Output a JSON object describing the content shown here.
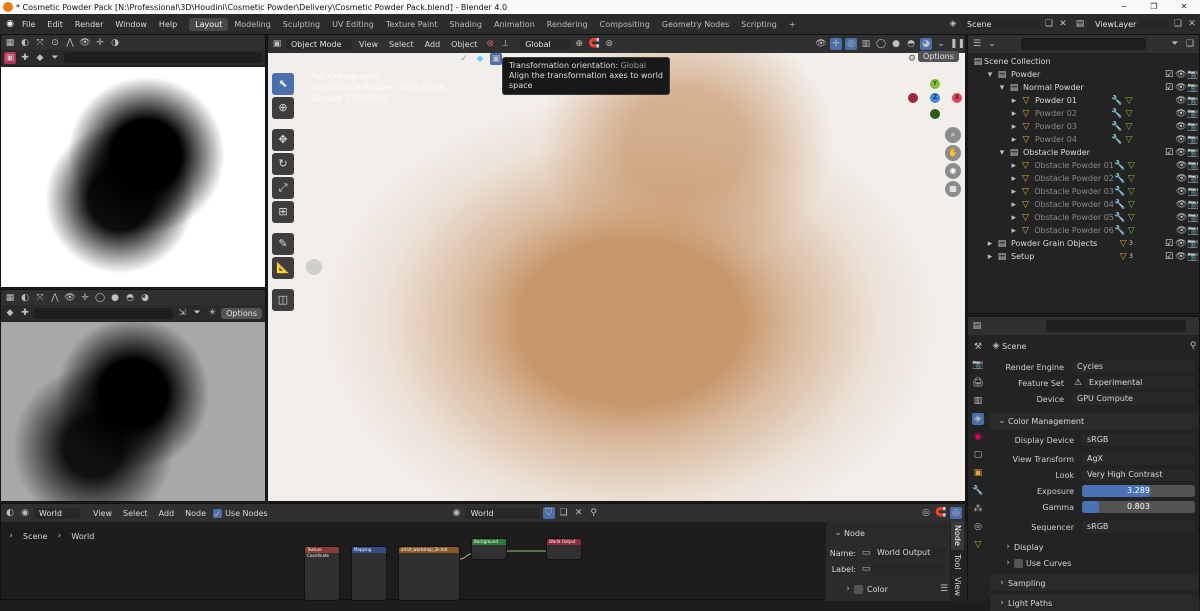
{
  "window": {
    "title": "* Cosmetic Powder Pack [N:\\Professional\\3D\\Houdini\\Cosmetic Powder\\Delivery\\Cosmetic Powder Pack.blend] - Blender 4.0",
    "minimize": "─",
    "maximize": "❐",
    "close": "✕"
  },
  "menu": [
    "File",
    "Edit",
    "Render",
    "Window",
    "Help"
  ],
  "workspaces": [
    "Layout",
    "Modeling",
    "Sculpting",
    "UV Editing",
    "Texture Paint",
    "Shading",
    "Animation",
    "Rendering",
    "Compositing",
    "Geometry Nodes",
    "Scripting"
  ],
  "workspace_add": "+",
  "scene": {
    "label": "Scene",
    "view_layer": "ViewLayer"
  },
  "left_bottom_header": {
    "options": "Options"
  },
  "viewport": {
    "mode": "Object Mode",
    "menu": [
      "View",
      "Select",
      "Add",
      "Object"
    ],
    "orientation": "Global",
    "options": "Options",
    "overlay_lines": [
      "Top Orthographic",
      "(1) Obstacle Powder | Base Plane",
      "Sample 1767/5000"
    ],
    "tooltip_title": "Transformation orientation:",
    "tooltip_value": "Global",
    "tooltip_desc": "Align the transformation axes to world space",
    "gizmo": {
      "y": "Y",
      "x": "X",
      "z": "Z"
    }
  },
  "outliner": {
    "root": "Scene Collection",
    "items": [
      {
        "label": "Powder",
        "level": 1
      },
      {
        "label": "Normal Powder",
        "level": 2
      },
      {
        "label": "Powder 01",
        "level": 3
      },
      {
        "label": "Powder 02",
        "level": 3
      },
      {
        "label": "Powder 03",
        "level": 3
      },
      {
        "label": "Powder 04",
        "level": 3
      },
      {
        "label": "Obstacle Powder",
        "level": 2
      },
      {
        "label": "Obstacle Powder 01",
        "level": 3
      },
      {
        "label": "Obstacle Powder 02",
        "level": 3
      },
      {
        "label": "Obstacle Powder 03",
        "level": 3
      },
      {
        "label": "Obstacle Powder 04",
        "level": 3
      },
      {
        "label": "Obstacle Powder 05",
        "level": 3
      },
      {
        "label": "Obstacle Powder 06",
        "level": 3
      },
      {
        "label": "Powder Grain Objects",
        "level": 1
      },
      {
        "label": "Setup",
        "level": 1
      }
    ],
    "badge_grain": "3",
    "badge_setup": "3"
  },
  "properties": {
    "title": "Scene",
    "render_engine_label": "Render Engine",
    "render_engine": "Cycles",
    "feature_set_label": "Feature Set",
    "feature_set": "Experimental",
    "device_label": "Device",
    "device": "GPU Compute",
    "color_mgmt": "Color Management",
    "display_device_label": "Display Device",
    "display_device": "sRGB",
    "view_transform_label": "View Transform",
    "view_transform": "AgX",
    "look_label": "Look",
    "look": "Very High Contrast",
    "exposure_label": "Exposure",
    "exposure": "3.289",
    "exposure_fill": 0.6,
    "gamma_label": "Gamma",
    "gamma": "0.803",
    "gamma_fill": 0.15,
    "sequencer_label": "Sequencer",
    "sequencer": "sRGB",
    "display": "Display",
    "use_curves": "Use Curves",
    "sampling": "Sampling",
    "light_paths": "Light Paths"
  },
  "node_editor": {
    "type": "World",
    "menu": [
      "View",
      "Select",
      "Add",
      "Node"
    ],
    "use_nodes": "Use Nodes",
    "world_name": "World",
    "breadcrumb": [
      "Scene",
      "World"
    ],
    "side": {
      "header": "Node",
      "name_label": "Name:",
      "name": "World Output",
      "label_label": "Label:",
      "color": "Color"
    },
    "tabs": [
      "Node",
      "Tool",
      "View"
    ],
    "nodes": [
      "Texture Coordinate",
      "Mapping",
      "artist_workshop_2k.hdr",
      "Background",
      "World Output"
    ]
  }
}
